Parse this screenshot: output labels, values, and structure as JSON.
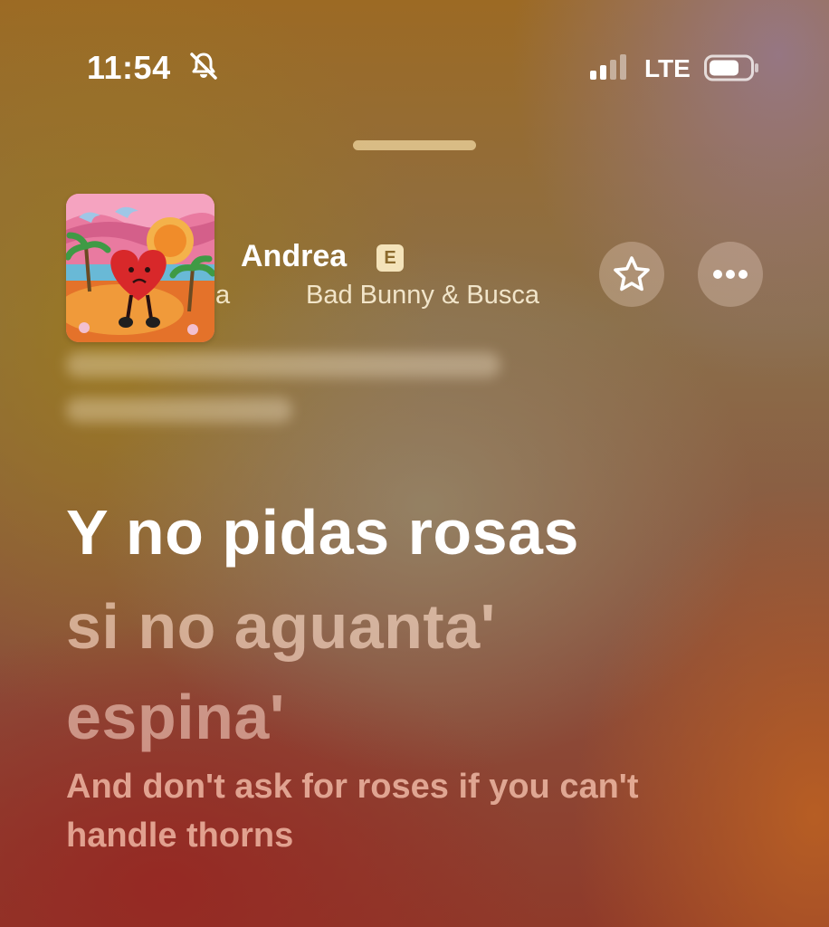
{
  "status_bar": {
    "time": "11:54",
    "network": "LTE",
    "icons": [
      "bell-slash-icon",
      "cellular-signal-icon",
      "battery-icon"
    ]
  },
  "now_playing": {
    "title": "Andrea",
    "explicit_badge": "E",
    "artist_fragment": "a",
    "artist": "Bad Bunny & Busca",
    "album_art": "album-cover",
    "buttons": {
      "favorite_icon": "star-icon",
      "more_icon": "ellipsis-icon"
    }
  },
  "lyrics": {
    "current_line": "Y no pidas rosas",
    "next_line_1": "si no aguanta'",
    "next_line_2": "espina'",
    "translation": "And don't ask for roses if you can't handle thorns"
  },
  "colors": {
    "current_lyric": "#ffffff",
    "upcoming_lyric": "#f2d6c6",
    "translation": "#f5c2ad",
    "badge_bg": "#fff0c8"
  }
}
